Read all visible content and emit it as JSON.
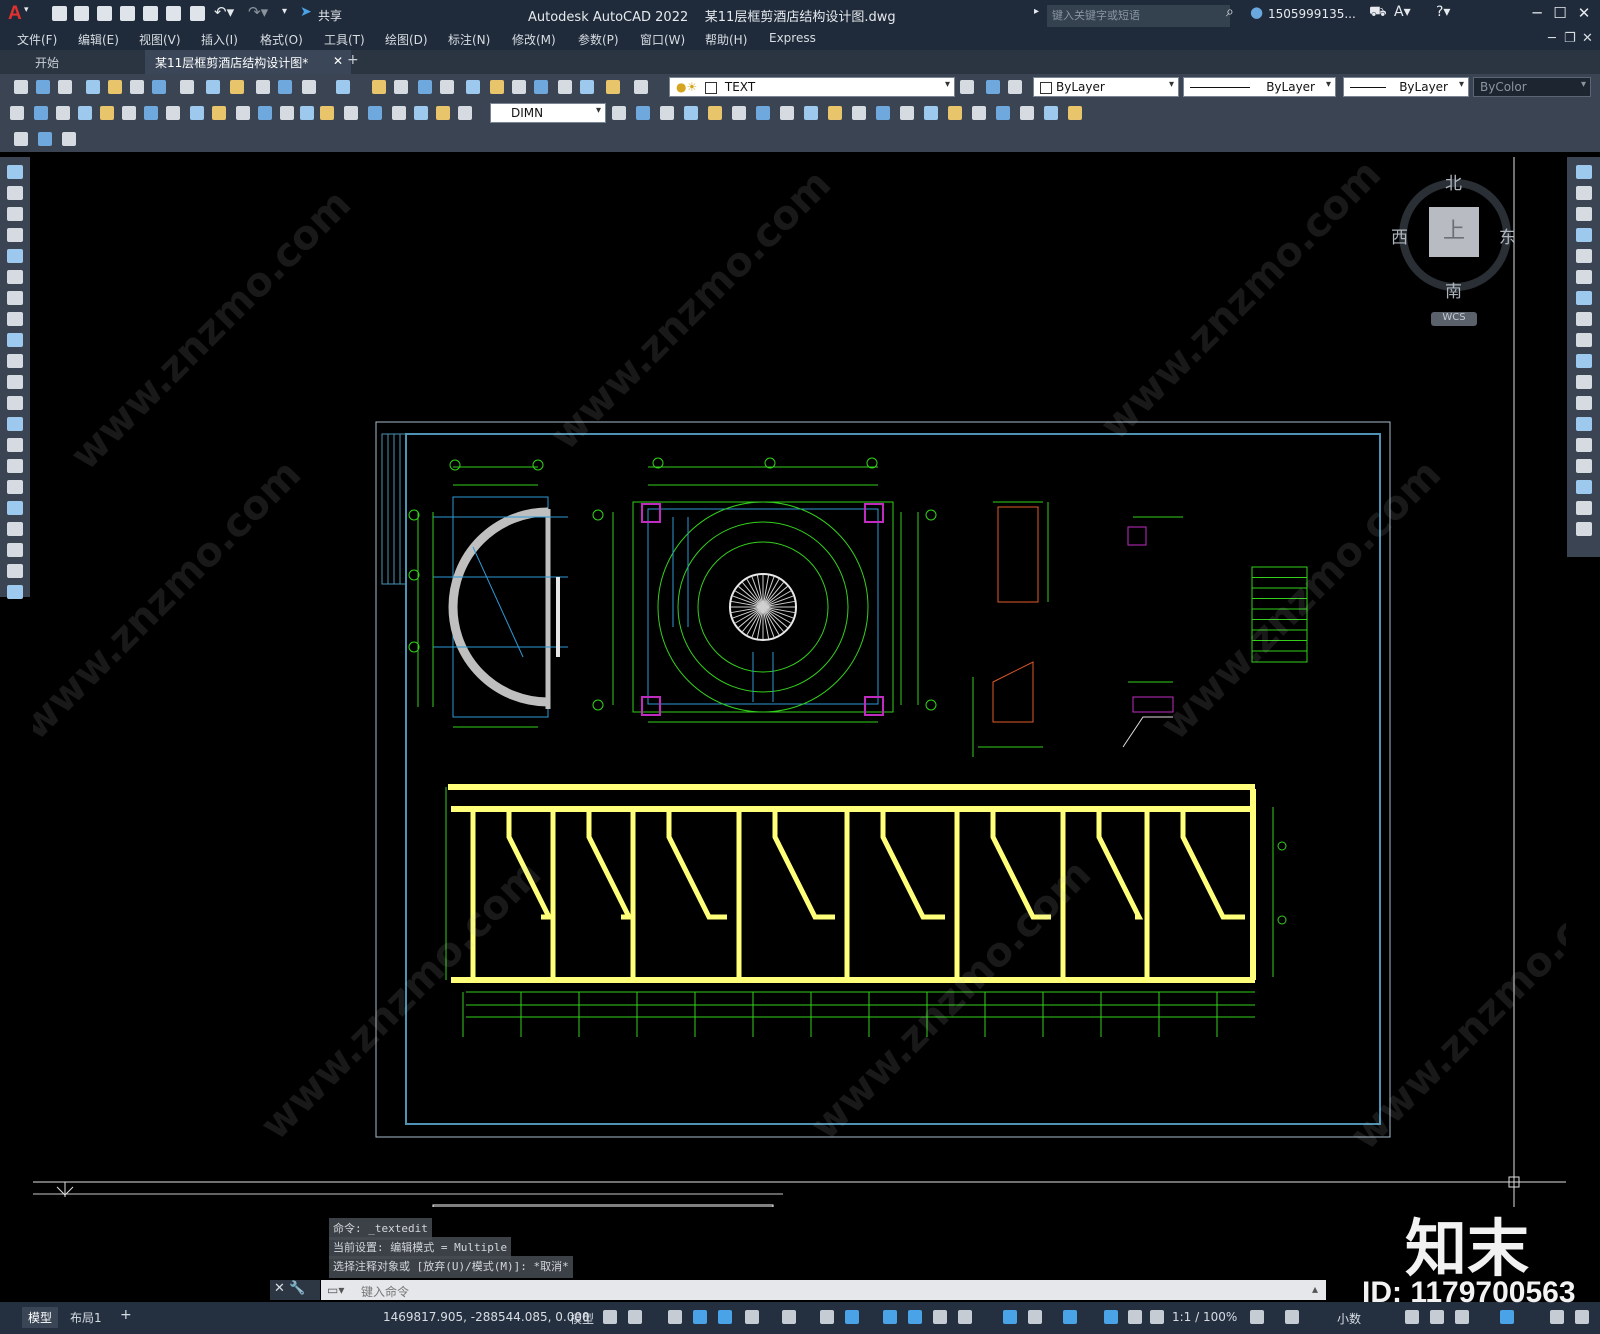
{
  "app": {
    "title": "Autodesk AutoCAD 2022",
    "document": "某11层框剪酒店结构设计图.dwg",
    "share_label": "共享",
    "search_placeholder": "键入关键字或短语",
    "user": "1505999135...",
    "logo_letter": "A"
  },
  "menu": [
    "文件(F)",
    "编辑(E)",
    "视图(V)",
    "插入(I)",
    "格式(O)",
    "工具(T)",
    "绘图(D)",
    "标注(N)",
    "修改(M)",
    "参数(P)",
    "窗口(W)",
    "帮助(H)",
    "Express"
  ],
  "tabs": [
    {
      "label": "开始",
      "active": false
    },
    {
      "label": "某11层框剪酒店结构设计图*",
      "active": true
    }
  ],
  "toolbar": {
    "layer_name": "TEXT",
    "color": "ByLayer",
    "linetype": "ByLayer",
    "lineweight": "ByLayer",
    "plotstyle": "ByColor",
    "dimstyle": "DIMN"
  },
  "viewcube": {
    "north": "北",
    "south": "南",
    "east": "东",
    "west": "西",
    "face": "上",
    "ucs": "WCS"
  },
  "command": {
    "history": [
      "命令: _textedit",
      "当前设置: 编辑模式 = Multiple",
      "选择注释对象或 [放弃(U)/模式(M)]: *取消*"
    ],
    "input_placeholder": "键入命令"
  },
  "layout_tabs": [
    "模型",
    "布局1"
  ],
  "status": {
    "coordinates": "1469817.905, -288544.085, 0.000",
    "space": "模型",
    "scale": "1:1 / 100%",
    "units": "小数"
  },
  "watermark": {
    "logo": "知末",
    "id": "ID: 1179700563",
    "site": "www.znzmo.com"
  },
  "colors": {
    "titlebar": "#1f2b3a",
    "toolbar": "#3b4453",
    "canvas": "#000000",
    "accent": "#49a3e6"
  }
}
